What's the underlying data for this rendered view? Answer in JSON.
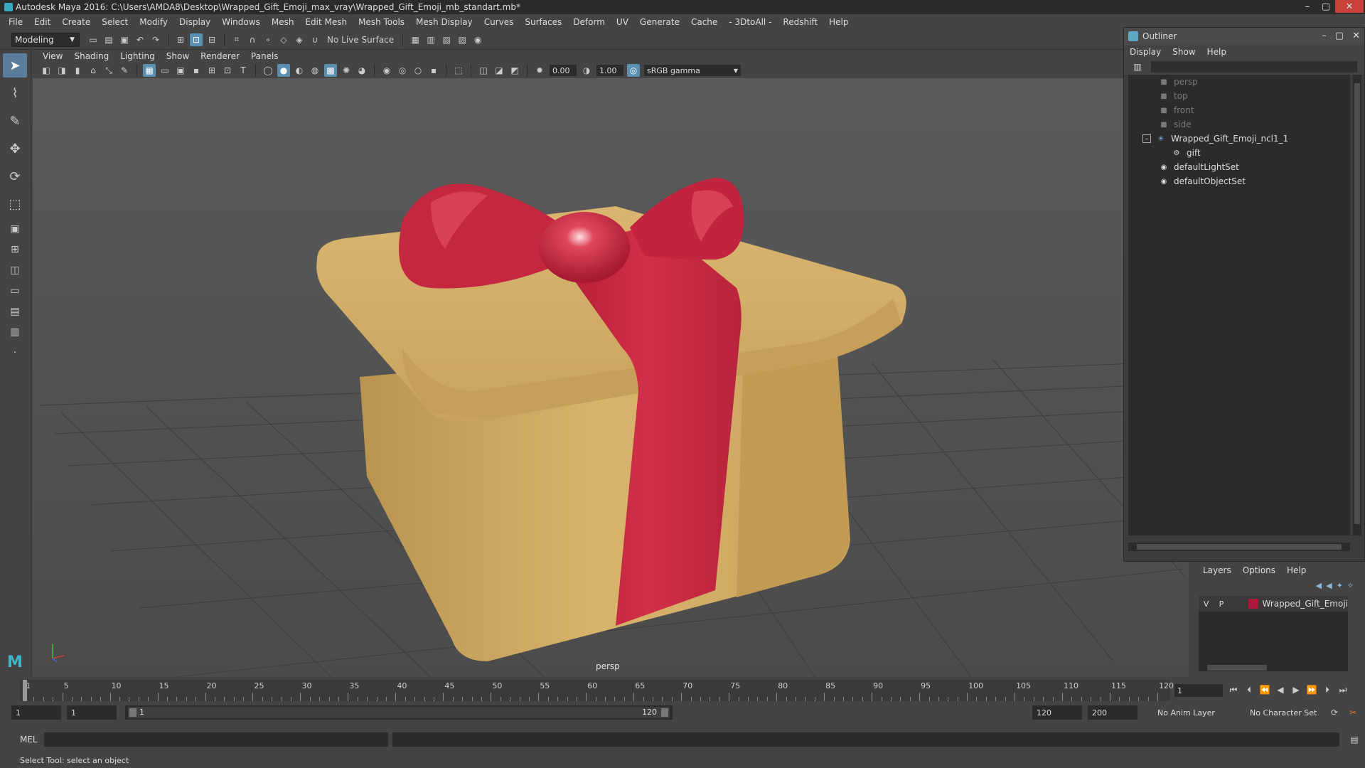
{
  "window": {
    "title": "Autodesk Maya 2016: C:\\Users\\AMDA8\\Desktop\\Wrapped_Gift_Emoji_max_vray\\Wrapped_Gift_Emoji_mb_standart.mb*",
    "btn_min": "–",
    "btn_max": "▢",
    "btn_close": "✕"
  },
  "menubar": [
    "File",
    "Edit",
    "Create",
    "Select",
    "Modify",
    "Display",
    "Windows",
    "Mesh",
    "Edit Mesh",
    "Mesh Tools",
    "Mesh Display",
    "Curves",
    "Surfaces",
    "Deform",
    "UV",
    "Generate",
    "Cache",
    "- 3DtoAll -",
    "Redshift",
    "Help"
  ],
  "shelf": {
    "mode": "Modeling",
    "live_surface": "No Live Surface"
  },
  "panel": {
    "menu": [
      "View",
      "Shading",
      "Lighting",
      "Show",
      "Renderer",
      "Panels"
    ],
    "exposure": "0.00",
    "gamma_value": "1.00",
    "color_space": "sRGB gamma",
    "camera_label": "persp"
  },
  "outliner": {
    "title": "Outliner",
    "menu": [
      "Display",
      "Show",
      "Help"
    ],
    "items": [
      {
        "label": "persp",
        "dim": true
      },
      {
        "label": "top",
        "dim": true
      },
      {
        "label": "front",
        "dim": true
      },
      {
        "label": "side",
        "dim": true
      },
      {
        "label": "Wrapped_Gift_Emoji_ncl1_1",
        "dim": false
      },
      {
        "label": "gift",
        "dim": false
      },
      {
        "label": "defaultLightSet",
        "dim": false
      },
      {
        "label": "defaultObjectSet",
        "dim": false
      }
    ]
  },
  "layers": {
    "menu": [
      "Layers",
      "Options",
      "Help"
    ],
    "row": {
      "v": "V",
      "p": "P",
      "name": "Wrapped_Gift_Emoji",
      "color": "#b0163a"
    }
  },
  "timeline": {
    "ticks": [
      "1",
      "5",
      "10",
      "15",
      "20",
      "25",
      "30",
      "35",
      "40",
      "45",
      "50",
      "55",
      "60",
      "65",
      "70",
      "75",
      "80",
      "85",
      "90",
      "95",
      "100",
      "105",
      "110",
      "115",
      "120"
    ],
    "current_frame": "1",
    "start_frame": "1",
    "playback_start": "1",
    "range_start": "1",
    "range_end": "120",
    "playback_end": "120",
    "anim_end": "200",
    "anim_layer": "No Anim Layer",
    "character_set": "No Character Set"
  },
  "command": {
    "label": "MEL"
  },
  "status": {
    "text": "Select Tool: select an object"
  },
  "colors": {
    "gift_box": "#d6b06a",
    "ribbon": "#c9263f",
    "accent": "#5b8fb0"
  }
}
